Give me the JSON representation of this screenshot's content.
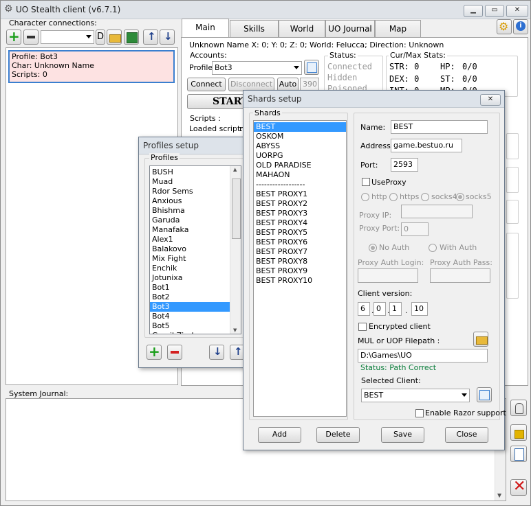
{
  "app": {
    "title": "UO Stealth client (v6.7.1)",
    "min": "▁",
    "max": "▭",
    "close": "✕",
    "settings_icon": "gear-icon",
    "info_icon": "info-icon"
  },
  "connections": {
    "label": "Character connections:",
    "d_label": "D",
    "selected": {
      "line1": "Profile: Bot3",
      "line2": "Char: Unknown Name",
      "line3": "Scripts: 0"
    }
  },
  "tabs": [
    "Main",
    "Skills",
    "World",
    "UO Journal",
    "Map"
  ],
  "main": {
    "status_line": "Unknown Name X: 0; Y: 0; Z: 0; World: Felucca; Direction: Unknown",
    "accounts_label": "Accounts:",
    "profile_label": "Profile:",
    "profile_value": "Bot3",
    "connect": "Connect",
    "disconnect": "Disconnect",
    "auto": "Auto",
    "auto_value": "390",
    "start": "START",
    "scripts_label": "Scripts :",
    "loaded_script": "Loaded script:",
    "loaded_script_value": "n",
    "status_label": "Status:",
    "status_items": [
      "Connected",
      "Hidden",
      "Poisoned"
    ],
    "stats_label": "Cur/Max Stats:",
    "stats": {
      "str": "STR: 0",
      "hp": "HP:",
      "hp_val": "0/0",
      "dex": "DEX: 0",
      "st": "ST:",
      "st_val": "0/0",
      "int": "INT: 0",
      "mp": "MP:",
      "mp_val": "0/0"
    }
  },
  "journal": {
    "label": "System Journal:"
  },
  "profiles_dialog": {
    "title": "Profiles setup",
    "group": "Profiles",
    "items": [
      "BUSH",
      "Muad",
      "Rdor Sems",
      "Anxious",
      "Bhishma",
      "Garuda",
      "Manafaka",
      "Alex1",
      "Balakovo",
      "Mix Fight",
      "Enchik",
      "Jotunixa",
      "Bot1",
      "Bot2",
      "Bot3",
      "Bot4",
      "Bot5",
      "Gamil Zirak"
    ],
    "selected_index": 14
  },
  "shards_dialog": {
    "title": "Shards setup",
    "close": "✕",
    "group": "Shards",
    "items": [
      "BEST",
      "OSKOM",
      "ABYSS",
      "UORPG",
      "OLD PARADISE",
      "MAHAON",
      "------------------",
      "BEST PROXY1",
      "BEST PROXY2",
      "BEST PROXY3",
      "BEST PROXY4",
      "BEST PROXY5",
      "BEST PROXY6",
      "BEST PROXY7",
      "BEST PROXY8",
      "BEST PROXY9",
      "BEST PROXY10"
    ],
    "selected_index": 0,
    "name_label": "Name:",
    "name_value": "BEST",
    "address_label": "Address:",
    "address_value": "game.bestuo.ru",
    "port_label": "Port:",
    "port_value": "2593",
    "use_proxy": "UseProxy",
    "proxy_types": [
      "http",
      "https",
      "socks4",
      "socks5"
    ],
    "proxy_ip_label": "Proxy IP:",
    "proxy_port_label": "Proxy Port:",
    "proxy_port_value": "0",
    "no_auth": "No Auth",
    "with_auth": "With Auth",
    "proxy_login_label": "Proxy Auth Login:",
    "proxy_pass_label": "Proxy Auth Pass:",
    "client_version_label": "Client version:",
    "client_version": [
      "6",
      "0",
      "1",
      "10"
    ],
    "encrypted": "Encrypted client",
    "mul_label": "MUL or UOP Filepath :",
    "mul_value": "D:\\Games\\UO",
    "path_status": "Status: Path Correct",
    "selected_client_label": "Selected Client:",
    "selected_client_value": "BEST",
    "razor": "Enable Razor support",
    "add": "Add",
    "delete": "Delete",
    "save": "Save",
    "close_btn": "Close"
  },
  "colors": {
    "selection": "#3399ff",
    "selected_conn_bg": "#fde2e2",
    "path_ok": "#0a7d3a",
    "titlebar": "#dfe3e8"
  }
}
